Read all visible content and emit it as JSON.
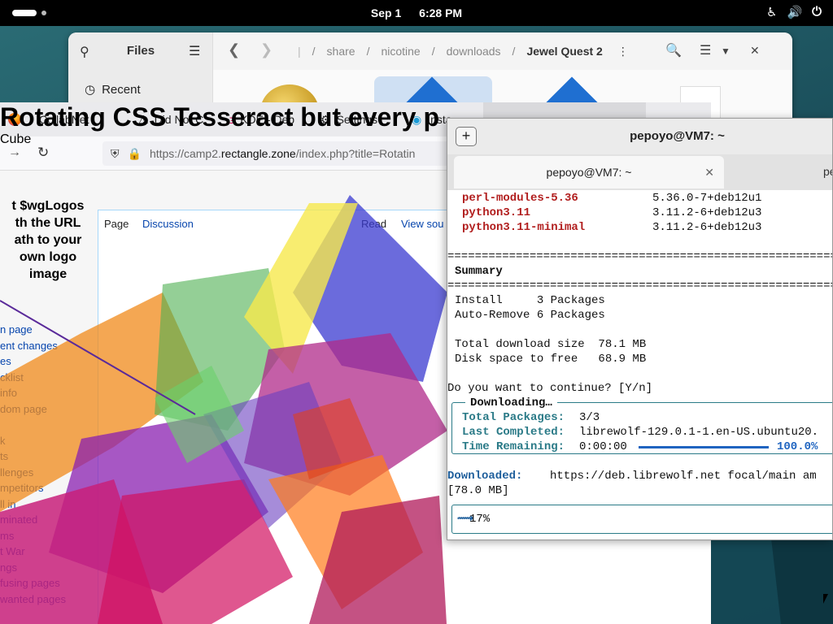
{
  "topbar": {
    "date": "Sep 1",
    "time": "6:28 PM",
    "tray_icons": [
      "accessibility-icon",
      "volume-icon",
      "power-icon"
    ]
  },
  "files": {
    "title": "Files",
    "recent_label": "Recent",
    "breadcrumbs": [
      "share",
      "nicotine",
      "downloads"
    ],
    "current_folder": "Jewel Quest 2"
  },
  "browser": {
    "tabs": [
      "CollabNet",
      "Did Not C",
      "KDE - Deb",
      "Settings",
      "Insta"
    ],
    "url_prefix": "https://camp2.",
    "url_domain": "rectangle.zone",
    "url_suffix": "/index.php?title=Rotatin",
    "page_tabs": [
      "Page",
      "Discussion",
      "Read",
      "View sou"
    ],
    "logo_text_lines": [
      "t $wgLogos",
      "th the URL",
      "ath to your",
      "own logo",
      "image"
    ],
    "heading": "Rotating CSS Tesseract but every p",
    "subheading": "Cube",
    "sidebar_links": [
      "n page",
      "ent changes",
      "es",
      "cklist",
      "info",
      "dom page",
      "",
      "k",
      "ts",
      "llenges",
      "mpetitors",
      "ll in",
      "minated",
      "ms",
      "t War",
      "ngs",
      "fusing pages",
      "wanted pages"
    ]
  },
  "terminal": {
    "window_title": "pepoyo@VM7: ~",
    "tab_title": "pepoyo@VM7: ~",
    "second_tab_label": "pe",
    "packages": [
      {
        "name": "perl-modules-5.36",
        "version": "5.36.0-7+deb12u1"
      },
      {
        "name": "python3.11",
        "version": "3.11.2-6+deb12u3"
      },
      {
        "name": "python3.11-minimal",
        "version": "3.11.2-6+deb12u3"
      }
    ],
    "separator": "========================================================================",
    "summary_heading": "Summary",
    "install_line": "Install     3 Packages",
    "autoremove_line": "Auto-Remove 6 Packages",
    "download_size_line": "Total download size  78.1 MB",
    "disk_space_line": "Disk space to free   68.9 MB",
    "prompt_line": "Do you want to continue? [Y/n]",
    "downloading_title": "Downloading…",
    "total_packages_label": "Total Packages:",
    "total_packages_value": "3/3",
    "last_completed_label": "Last Completed:",
    "last_completed_value": "librewolf-129.0.1-1.en-US.ubuntu20.",
    "time_remaining_label": "Time Remaining:",
    "time_remaining_value": "0:00:00",
    "download_percent": "100.0%",
    "download_fraction": 1.0,
    "downloaded_label": "Downloaded:",
    "downloaded_value": "https://deb.librewolf.net focal/main am",
    "downloaded_size": "[78.0 MB]",
    "install_progress": "17%"
  },
  "colors": {
    "package_name": "#b11d1d",
    "label_teal": "#2a7a87",
    "label_blue": "#1f5f9c",
    "progress_bar": "#1f64c0"
  }
}
